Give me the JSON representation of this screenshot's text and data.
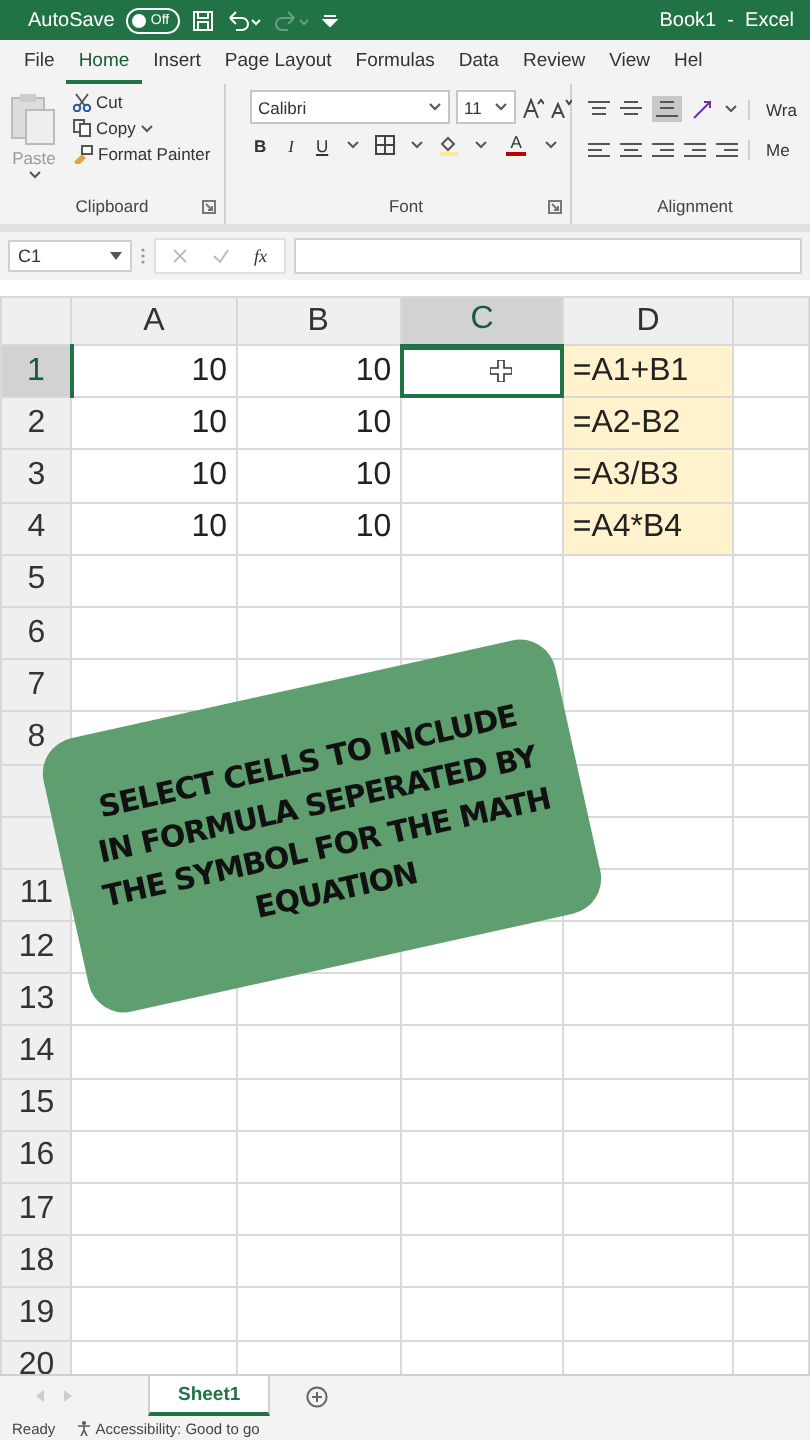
{
  "title_bar": {
    "autosave_label": "AutoSave",
    "autosave_toggle": {
      "label": "Off",
      "on": false
    },
    "title": "Book1  -  Excel"
  },
  "menu_tabs": [
    {
      "label": "File",
      "selected": false
    },
    {
      "label": "Home",
      "selected": true
    },
    {
      "label": "Insert",
      "selected": false
    },
    {
      "label": "Page Layout",
      "selected": false
    },
    {
      "label": "Formulas",
      "selected": false
    },
    {
      "label": "Data",
      "selected": false
    },
    {
      "label": "Review",
      "selected": false
    },
    {
      "label": "View",
      "selected": false
    },
    {
      "label": "Hel",
      "selected": false
    }
  ],
  "ribbon": {
    "clipboard": {
      "paste": "Paste",
      "cut": "Cut",
      "copy": "Copy",
      "format_painter": "Format Painter",
      "label": "Clipboard"
    },
    "font": {
      "font_name": "Calibri",
      "font_size": "11",
      "bold": "B",
      "italic": "I",
      "underline": "U",
      "font_color": "A",
      "label": "Font"
    },
    "alignment": {
      "wrap": "Wra",
      "merge": "Me",
      "label": "Alignment"
    }
  },
  "formula_bar": {
    "name_box": "C1",
    "fx": "fx"
  },
  "grid": {
    "columns": [
      {
        "label": "A",
        "selected": false
      },
      {
        "label": "B",
        "selected": false
      },
      {
        "label": "C",
        "selected": true
      },
      {
        "label": "D",
        "selected": false
      }
    ],
    "rows": [
      {
        "header": "1",
        "selected": true,
        "cells": [
          {
            "kind": "number",
            "text": "10",
            "selected": false,
            "filled": false
          },
          {
            "kind": "number",
            "text": "10",
            "selected": false,
            "filled": false
          },
          {
            "kind": "empty",
            "selected": true,
            "filled": false
          },
          {
            "kind": "text",
            "text": "=A1+B1",
            "selected": false,
            "filled": true
          }
        ]
      },
      {
        "header": "2",
        "selected": false,
        "cells": [
          {
            "kind": "number",
            "text": "10",
            "selected": false,
            "filled": false
          },
          {
            "kind": "number",
            "text": "10",
            "selected": false,
            "filled": false
          },
          {
            "kind": "empty",
            "selected": false,
            "filled": false
          },
          {
            "kind": "text",
            "text": "=A2-B2",
            "selected": false,
            "filled": true
          }
        ]
      },
      {
        "header": "3",
        "selected": false,
        "cells": [
          {
            "kind": "number",
            "text": "10",
            "selected": false,
            "filled": false
          },
          {
            "kind": "number",
            "text": "10",
            "selected": false,
            "filled": false
          },
          {
            "kind": "empty",
            "selected": false,
            "filled": false
          },
          {
            "kind": "text",
            "text": "=A3/B3",
            "selected": false,
            "filled": true
          }
        ]
      },
      {
        "header": "4",
        "selected": false,
        "cells": [
          {
            "kind": "number",
            "text": "10",
            "selected": false,
            "filled": false
          },
          {
            "kind": "number",
            "text": "10",
            "selected": false,
            "filled": false
          },
          {
            "kind": "empty",
            "selected": false,
            "filled": false
          },
          {
            "kind": "text",
            "text": "=A4*B4",
            "selected": false,
            "filled": true
          }
        ]
      },
      {
        "header": "5",
        "selected": false
      },
      {
        "header": "6",
        "selected": false
      },
      {
        "header": "7",
        "selected": false
      },
      {
        "header": "8",
        "selected": false
      },
      {
        "selected": false
      },
      {
        "selected": false
      },
      {
        "header": "11",
        "selected": false
      },
      {
        "header": "12",
        "selected": false
      },
      {
        "header": "13",
        "selected": false
      },
      {
        "header": "14",
        "selected": false
      },
      {
        "header": "15",
        "selected": false
      },
      {
        "header": "16",
        "selected": false
      },
      {
        "header": "17",
        "selected": false
      },
      {
        "header": "18",
        "selected": false
      },
      {
        "header": "19",
        "selected": false
      },
      {
        "header": "20",
        "selected": false
      }
    ]
  },
  "callout": {
    "lines": [
      "SELECT CELLS TO INCLUDE",
      "IN FORMULA SEPERATED BY",
      "THE SYMBOL FOR THE MATH",
      "EQUATION"
    ]
  },
  "sheet_tabs": [
    {
      "label": "Sheet1",
      "selected": true
    }
  ],
  "status_bar": {
    "status": "Ready",
    "accessibility": "Accessibility: Good to go"
  }
}
